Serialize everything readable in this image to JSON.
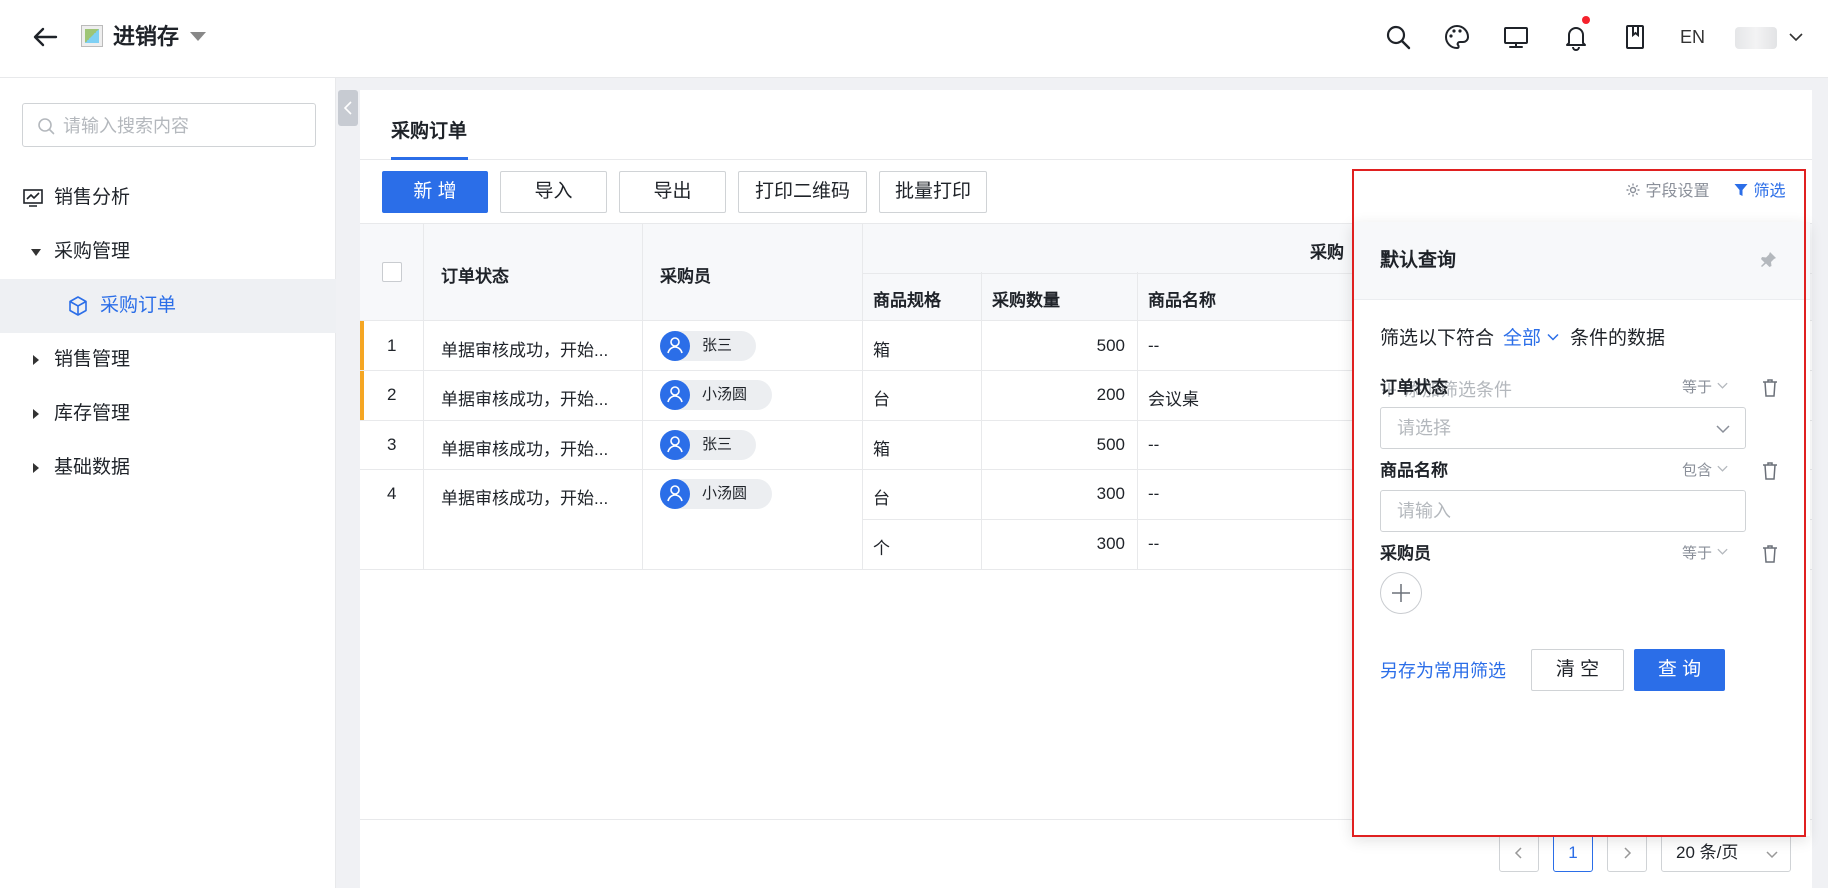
{
  "header": {
    "app_title": "进销存",
    "language": "EN"
  },
  "sidebar": {
    "search_placeholder": "请输入搜索内容",
    "items": [
      {
        "label": "销售分析",
        "icon": "chart-monitor-icon"
      },
      {
        "label": "采购管理",
        "expanded": true
      },
      {
        "label": "采购订单",
        "icon": "cube-icon",
        "active": true
      },
      {
        "label": "销售管理"
      },
      {
        "label": "库存管理"
      },
      {
        "label": "基础数据"
      }
    ]
  },
  "main": {
    "tab": "采购订单",
    "toolbar": {
      "add": "新 增",
      "import": "导入",
      "export": "导出",
      "print_qr": "打印二维码",
      "batch_print": "批量打印"
    },
    "table": {
      "headers": {
        "status": "订单状态",
        "buyer": "采购员",
        "group": "采购",
        "spec": "商品规格",
        "qty": "采购数量",
        "product": "商品名称"
      },
      "rows": [
        {
          "index": "1",
          "status": "单据审核成功，开始...",
          "buyer": "张三",
          "spec": "箱",
          "qty": "500",
          "product": "--"
        },
        {
          "index": "2",
          "status": "单据审核成功，开始...",
          "buyer": "小汤圆",
          "spec": "台",
          "qty": "200",
          "product": "会议桌"
        },
        {
          "index": "3",
          "status": "单据审核成功，开始...",
          "buyer": "张三",
          "spec": "箱",
          "qty": "500",
          "product": "--"
        },
        {
          "index": "4",
          "status": "单据审核成功，开始...",
          "buyer": "小汤圆",
          "spec": "台",
          "qty": "300",
          "product": "--"
        }
      ],
      "extra_row": {
        "spec": "个",
        "qty": "300",
        "product": "--"
      }
    },
    "pagination": {
      "current_page": "1",
      "page_size": "20 条/页"
    }
  },
  "filter": {
    "field_settings": "字段设置",
    "filter_label": "筛选",
    "panel_title": "默认查询",
    "condition_prefix": "筛选以下符合",
    "condition_mode": "全部",
    "condition_suffix": "条件的数据",
    "add_condition": "添加筛选条件",
    "fields": [
      {
        "label": "订单状态",
        "operator": "等于",
        "placeholder": "请选择"
      },
      {
        "label": "商品名称",
        "operator": "包含",
        "placeholder": "请输入"
      },
      {
        "label": "采购员",
        "operator": "等于"
      }
    ],
    "save_common": "另存为常用筛选",
    "clear": "清 空",
    "query": "查 询"
  },
  "colors": {
    "primary": "#2b6ee8",
    "row_flag": "#f5a623",
    "highlight_border": "#e02020",
    "notification_dot": "#f5222d"
  }
}
